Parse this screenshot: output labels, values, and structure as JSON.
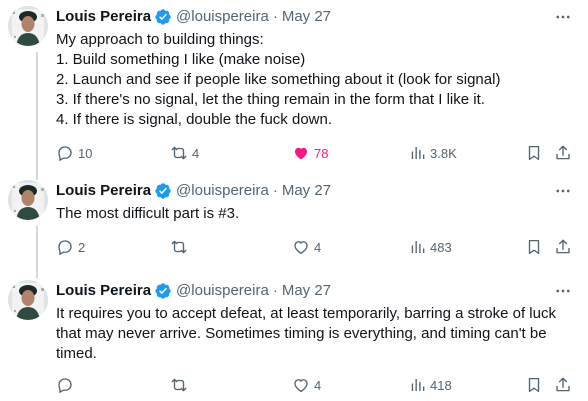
{
  "colors": {
    "text": "#0f1419",
    "muted": "#536471",
    "verified": "#1d9bf0",
    "liked": "#f91880",
    "thread_line": "#cfd9de"
  },
  "tweets": [
    {
      "author": {
        "name": "Louis Pereira",
        "handle": "@louispereira",
        "separator": "·",
        "date": "May 27"
      },
      "text": "My approach to building things:\n1. Build something I like (make noise)\n2. Launch and see if people like something about it (look for signal)\n3. If there's no signal, let the thing remain in the form that I like it.\n4. If there is signal, double the fuck down.",
      "counts": {
        "replies": "10",
        "reposts": "4",
        "likes": "78",
        "views": "3.8K"
      },
      "liked": true
    },
    {
      "author": {
        "name": "Louis Pereira",
        "handle": "@louispereira",
        "separator": "·",
        "date": "May 27"
      },
      "text": "The most difficult part is #3.",
      "counts": {
        "replies": "2",
        "reposts": "",
        "likes": "4",
        "views": "483"
      },
      "liked": false
    },
    {
      "author": {
        "name": "Louis Pereira",
        "handle": "@louispereira",
        "separator": "·",
        "date": "May 27"
      },
      "text": "It requires you to accept defeat, at least temporarily, barring a stroke of luck that may never arrive. Sometimes timing is everything, and timing can't be timed.",
      "counts": {
        "replies": "",
        "reposts": "",
        "likes": "4",
        "views": "418"
      },
      "liked": false
    }
  ],
  "icons": {
    "verified": "verified-badge-icon",
    "more": "more-options-icon",
    "reply": "reply-icon",
    "repost": "repost-icon",
    "like": "heart-icon",
    "views": "views-icon",
    "bookmark": "bookmark-icon",
    "share": "share-icon"
  }
}
